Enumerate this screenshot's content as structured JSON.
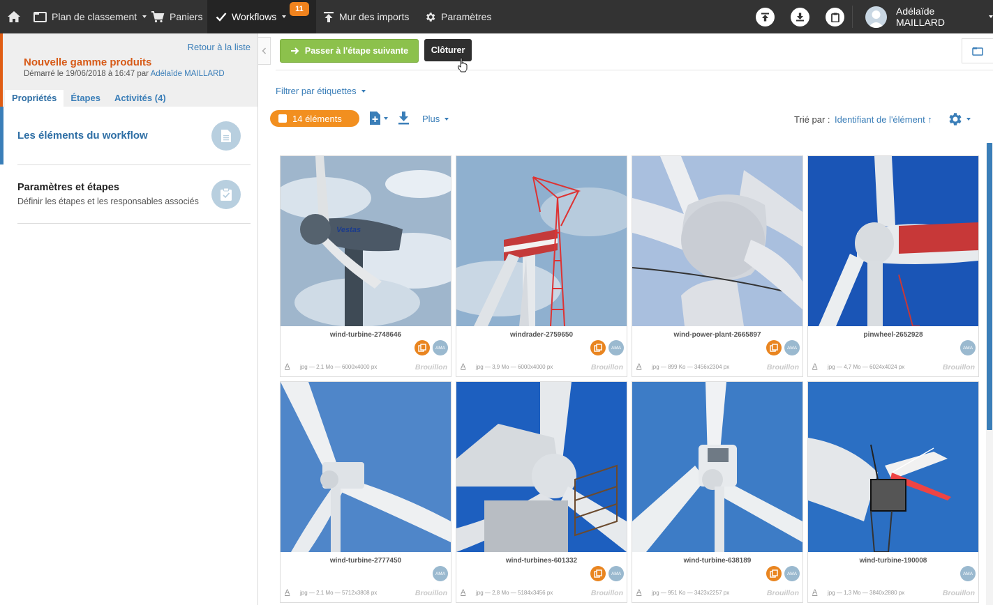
{
  "topbar": {
    "home_label": "",
    "plan_label": "Plan de classement",
    "baskets_label": "Paniers",
    "workflows_label": "Workflows",
    "workflows_badge": "11",
    "imports_label": "Mur des imports",
    "settings_label": "Paramètres",
    "user_name": "Adélaïde MAILLARD"
  },
  "sidebar": {
    "back_link": "Retour à la liste",
    "workflow_title": "Nouvelle gamme produits",
    "started_prefix": "Démarré le 19/06/2018 à 16:47 par",
    "started_by": "Adélaïde MAILLARD",
    "tabs": [
      "Propriétés",
      "Étapes",
      "Activités (4)"
    ],
    "section1_title": "Les éléments du workflow",
    "section2_title": "Paramètres et étapes",
    "section2_subtitle": "Définir les étapes et les responsables associés"
  },
  "toolbar": {
    "next_step_label": "Passer à l'étape suivante",
    "close_label": "Clôturer",
    "filter_label": "Filtrer par étiquettes",
    "count_label": "14 éléments",
    "more_label": "Plus",
    "sort_prefix": "Trié par :",
    "sort_value": "Identifiant de l'élément ↑"
  },
  "cards": [
    {
      "name": "wind-turbine-2748646",
      "meta": "jpg — 2,1 Mo — 6000x4000 px",
      "status": "Brouillon",
      "copy_icon": true,
      "avatar": "AMA"
    },
    {
      "name": "windrader-2759650",
      "meta": "jpg — 3,9 Mo — 6000x4000 px",
      "status": "Brouillon",
      "copy_icon": true,
      "avatar": "AMA"
    },
    {
      "name": "wind-power-plant-2665897",
      "meta": "jpg — 899 Ko — 3456x2304 px",
      "status": "Brouillon",
      "copy_icon": true,
      "avatar": "AMA"
    },
    {
      "name": "pinwheel-2652928",
      "meta": "jpg — 4,7 Mo — 6024x4024 px",
      "status": "Brouillon",
      "copy_icon": false,
      "avatar": "AMA"
    },
    {
      "name": "wind-turbine-2777450",
      "meta": "jpg — 2,1 Mo — 5712x3808 px",
      "status": "Brouillon",
      "copy_icon": false,
      "avatar": "AMA"
    },
    {
      "name": "wind-turbines-601332",
      "meta": "jpg — 2,8 Mo — 5184x3456 px",
      "status": "Brouillon",
      "copy_icon": true,
      "avatar": "AMA"
    },
    {
      "name": "wind-turbine-638189",
      "meta": "jpg — 951 Ko — 3423x2257 px",
      "status": "Brouillon",
      "copy_icon": true,
      "avatar": "AMA"
    },
    {
      "name": "wind-turbine-190008",
      "meta": "jpg — 1,3 Mo — 3840x2880 px",
      "status": "Brouillon",
      "copy_icon": false,
      "avatar": "AMA"
    }
  ],
  "colors": {
    "topbar": "#333333",
    "accent_orange": "#f28f1f",
    "link_blue": "#3a7eb8",
    "green": "#8cc14c",
    "title_orange": "#d75a17"
  }
}
